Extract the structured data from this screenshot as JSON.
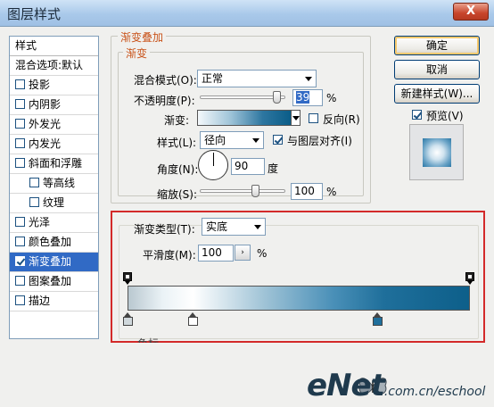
{
  "window": {
    "title": "图层样式",
    "close_glyph": "X"
  },
  "styles_list": {
    "header": "样式",
    "items": [
      {
        "label": "混合选项:默认",
        "checkbox": false,
        "checked": false,
        "indent": false,
        "selected": false
      },
      {
        "label": "投影",
        "checkbox": true,
        "checked": false,
        "indent": false,
        "selected": false
      },
      {
        "label": "内阴影",
        "checkbox": true,
        "checked": false,
        "indent": false,
        "selected": false
      },
      {
        "label": "外发光",
        "checkbox": true,
        "checked": false,
        "indent": false,
        "selected": false
      },
      {
        "label": "内发光",
        "checkbox": true,
        "checked": false,
        "indent": false,
        "selected": false
      },
      {
        "label": "斜面和浮雕",
        "checkbox": true,
        "checked": false,
        "indent": false,
        "selected": false
      },
      {
        "label": "等高线",
        "checkbox": true,
        "checked": false,
        "indent": true,
        "selected": false
      },
      {
        "label": "纹理",
        "checkbox": true,
        "checked": false,
        "indent": true,
        "selected": false
      },
      {
        "label": "光泽",
        "checkbox": true,
        "checked": false,
        "indent": false,
        "selected": false
      },
      {
        "label": "颜色叠加",
        "checkbox": true,
        "checked": false,
        "indent": false,
        "selected": false
      },
      {
        "label": "渐变叠加",
        "checkbox": true,
        "checked": true,
        "indent": false,
        "selected": true
      },
      {
        "label": "图案叠加",
        "checkbox": true,
        "checked": false,
        "indent": false,
        "selected": false
      },
      {
        "label": "描边",
        "checkbox": true,
        "checked": false,
        "indent": false,
        "selected": false
      }
    ]
  },
  "gradient_overlay": {
    "group_title": "渐变叠加",
    "sub_title": "渐变",
    "blend_mode_label": "混合模式(O):",
    "blend_mode_value": "正常",
    "opacity_label": "不透明度(P):",
    "opacity_value": "39",
    "opacity_fraction": 0.39,
    "opacity_unit": "%",
    "gradient_label": "渐变:",
    "reverse_label": "反向(R)",
    "reverse_checked": false,
    "style_label": "样式(L):",
    "style_value": "径向",
    "align_label": "与图层对齐(I)",
    "align_checked": true,
    "angle_label": "角度(N):",
    "angle_value": "90",
    "angle_unit": "度",
    "scale_label": "缩放(S):",
    "scale_value": "100",
    "scale_fraction": 0.4,
    "scale_unit": "%"
  },
  "gradient_editor": {
    "type_label": "渐变类型(T):",
    "type_value": "实底",
    "smoothness_label": "平滑度(M):",
    "smoothness_value": "100",
    "smoothness_unit": "%",
    "stepper_glyph": "›",
    "cut_label": "色标",
    "opacity_stops": [
      0.0,
      1.0
    ],
    "color_stops": [
      {
        "position": 0.0,
        "color": "#d0d8dc"
      },
      {
        "position": 0.19,
        "color": "#ffffff"
      },
      {
        "position": 0.73,
        "color": "#1f6f9b"
      }
    ]
  },
  "buttons": {
    "ok": "确定",
    "cancel": "取消",
    "new_style": "新建样式(W)...",
    "preview_label": "预览(V)",
    "preview_checked": true
  },
  "watermark": {
    "brand": "eNet",
    "suffix": ".com.cn/eschool"
  },
  "colors": {
    "accent_legend": "#c9541c",
    "selection": "#316ac5",
    "highlight_border": "#d32a2a"
  }
}
